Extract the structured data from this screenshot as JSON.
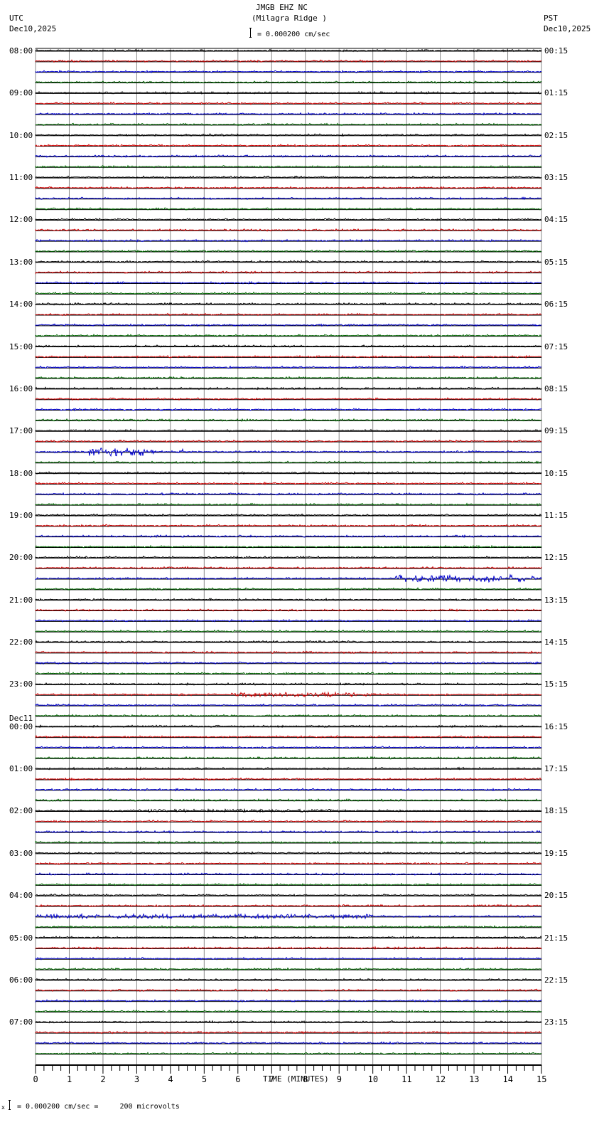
{
  "header": {
    "station": "JMGB EHZ NC",
    "location": "(Milagra Ridge )",
    "left_tz": "UTC",
    "left_date": "Dec10,2025",
    "right_tz": "PST",
    "right_date": "Dec10,2025",
    "scale": "= 0.000200 cm/sec"
  },
  "footer": {
    "scale": "= 0.000200 cm/sec =     200 microvolts",
    "mark": "x"
  },
  "colors": {
    "trace_cycle": [
      "#000000",
      "#cc0000",
      "#0000cc",
      "#006600"
    ],
    "grid": "#888888"
  },
  "chart_data": {
    "type": "line",
    "title": "JMGB EHZ NC (Milagra Ridge )",
    "xlabel": "TIME (MINUTES)",
    "xlim": [
      0,
      15
    ],
    "x_ticks": [
      "0",
      "1",
      "2",
      "3",
      "4",
      "5",
      "6",
      "7",
      "8",
      "9",
      "10",
      "11",
      "12",
      "13",
      "14",
      "15"
    ],
    "rows": 96,
    "minutes_per_row": 15,
    "left_labels": [
      {
        "row": 0,
        "text": "08:00"
      },
      {
        "row": 4,
        "text": "09:00"
      },
      {
        "row": 8,
        "text": "10:00"
      },
      {
        "row": 12,
        "text": "11:00"
      },
      {
        "row": 16,
        "text": "12:00"
      },
      {
        "row": 20,
        "text": "13:00"
      },
      {
        "row": 24,
        "text": "14:00"
      },
      {
        "row": 28,
        "text": "15:00"
      },
      {
        "row": 32,
        "text": "16:00"
      },
      {
        "row": 36,
        "text": "17:00"
      },
      {
        "row": 40,
        "text": "18:00"
      },
      {
        "row": 44,
        "text": "19:00"
      },
      {
        "row": 48,
        "text": "20:00"
      },
      {
        "row": 52,
        "text": "21:00"
      },
      {
        "row": 56,
        "text": "22:00"
      },
      {
        "row": 60,
        "text": "23:00"
      },
      {
        "row": 64,
        "text": "00:00",
        "date": "Dec11"
      },
      {
        "row": 68,
        "text": "01:00"
      },
      {
        "row": 72,
        "text": "02:00"
      },
      {
        "row": 76,
        "text": "03:00"
      },
      {
        "row": 80,
        "text": "04:00"
      },
      {
        "row": 84,
        "text": "05:00"
      },
      {
        "row": 88,
        "text": "06:00"
      },
      {
        "row": 92,
        "text": "07:00"
      }
    ],
    "right_labels": [
      "00:15",
      "01:15",
      "02:15",
      "03:15",
      "04:15",
      "05:15",
      "06:15",
      "07:15",
      "08:15",
      "09:15",
      "10:15",
      "11:15",
      "12:15",
      "13:15",
      "14:15",
      "15:15",
      "16:15",
      "17:15",
      "18:15",
      "19:15",
      "20:15",
      "21:15",
      "22:15",
      "23:15"
    ],
    "events": [
      {
        "row": 38,
        "start": 1.6,
        "end": 3.5,
        "amp": 6
      },
      {
        "row": 38,
        "start": 4.2,
        "end": 4.4,
        "amp": 4
      },
      {
        "row": 50,
        "start": 10.6,
        "end": 14.8,
        "amp": 5
      },
      {
        "row": 61,
        "start": 5.8,
        "end": 10.0,
        "amp": 3
      },
      {
        "row": 72,
        "start": 3.0,
        "end": 9.0,
        "amp": 2
      },
      {
        "row": 82,
        "start": 0.0,
        "end": 10.0,
        "amp": 3
      }
    ]
  }
}
